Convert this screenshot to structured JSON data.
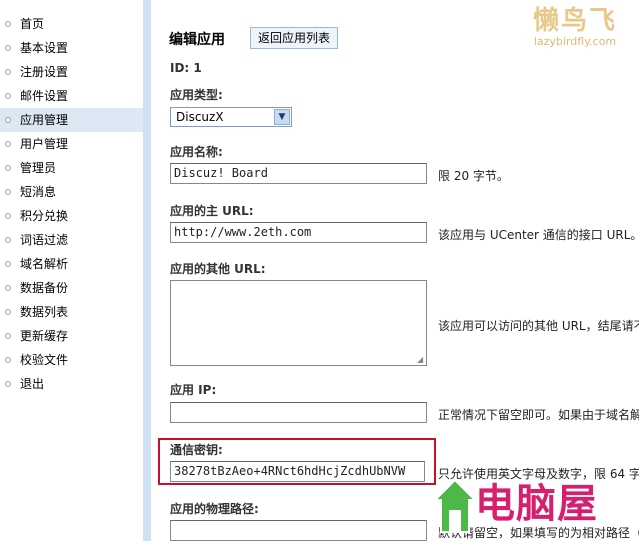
{
  "sidebar": {
    "items": [
      {
        "label": "首页"
      },
      {
        "label": "基本设置"
      },
      {
        "label": "注册设置"
      },
      {
        "label": "邮件设置"
      },
      {
        "label": "应用管理",
        "active": true
      },
      {
        "label": "用户管理"
      },
      {
        "label": "管理员"
      },
      {
        "label": "短消息"
      },
      {
        "label": "积分兑换"
      },
      {
        "label": "词语过滤"
      },
      {
        "label": "域名解析"
      },
      {
        "label": "数据备份"
      },
      {
        "label": "数据列表"
      },
      {
        "label": "更新缓存"
      },
      {
        "label": "校验文件"
      },
      {
        "label": "退出"
      }
    ]
  },
  "header": {
    "title": "编辑应用",
    "back_button": "返回应用列表"
  },
  "form": {
    "id_text": "ID: 1",
    "app_type": {
      "label": "应用类型:",
      "value": "DiscuzX"
    },
    "app_name": {
      "label": "应用名称:",
      "value": "Discuz! Board",
      "hint": "限 20 字节。"
    },
    "main_url": {
      "label": "应用的主 URL:",
      "value": "http://www.2eth.com",
      "hint": "该应用与 UCenter 通信的接口 URL。"
    },
    "other_url": {
      "label": "应用的其他 URL:",
      "value": "",
      "hint": "该应用可以访问的其他 URL，结尾请不"
    },
    "app_ip": {
      "label": "应用 IP:",
      "value": "",
      "hint": "正常情况下留空即可。如果由于域名解"
    },
    "comm_key": {
      "label": "通信密钥:",
      "value": "38278tBzAeo+4RNct6hdHcjZcdhUbNVW",
      "hint": "只允许使用英文字母及数字，限 64 字"
    },
    "physical_path": {
      "label": "应用的物理路径:",
      "value": "",
      "hint": "默认请留空，如果填写的为相对路径（"
    }
  },
  "watermarks": {
    "top_cn": "懒鸟飞",
    "top_url": "lazybirdfly.com",
    "bottom_cn": "电脑屋"
  },
  "colors": {
    "highlight_border": "#c8102e",
    "sidebar_divider": "#cfe1f2",
    "active_item": "#dce8f4"
  }
}
